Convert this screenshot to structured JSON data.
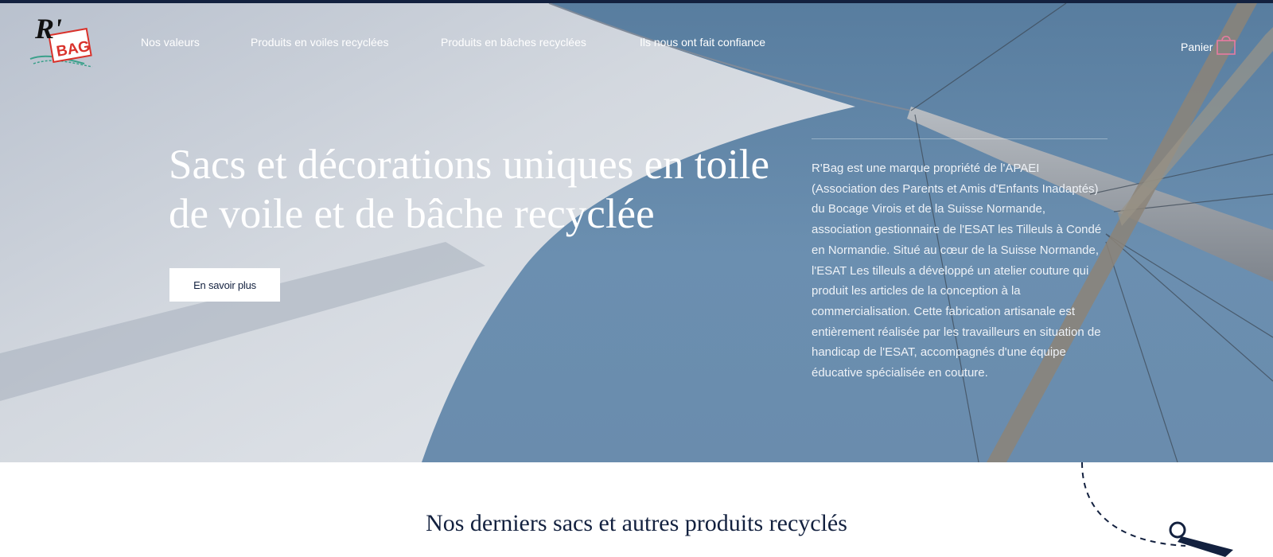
{
  "brand": {
    "logo_text": "BAG",
    "logo_letter": "R'"
  },
  "nav": [
    {
      "label": "Nos valeurs"
    },
    {
      "label": "Produits en voiles recyclées"
    },
    {
      "label": "Produits en bâches recyclées"
    },
    {
      "label": "Ils nous ont fait confiance"
    }
  ],
  "cart": {
    "label": "Panier",
    "icon": "shopping-bag-icon"
  },
  "hero": {
    "headline": "Sacs et décorations uniques en toile de voile et de bâche recyclée",
    "cta_label": "En savoir plus",
    "about": "R'Bag est une marque propriété de l'APAEI (Association des Parents et Amis d'Enfants Inadaptés) du Bocage Virois et de la Suisse Normande, association gestionnaire de l'ESAT les Tilleuls à Condé en Normandie. Situé au cœur de la Suisse Normande, l'ESAT Les tilleuls a développé un atelier couture qui produit les articles de la conception à la commercialisation. Cette fabrication artisanale est entièrement réalisée par les travailleurs en situation de handicap de l'ESAT, accompagnés d'une équipe éducative spécialisée en couture."
  },
  "section": {
    "title": "Nos derniers sacs et autres produits recyclés"
  },
  "colors": {
    "navy": "#13213f",
    "sky": "#6b8fb0",
    "sail": "#e4e7ec",
    "cart_pink": "#e87ba1",
    "logo_red": "#d9322b"
  }
}
